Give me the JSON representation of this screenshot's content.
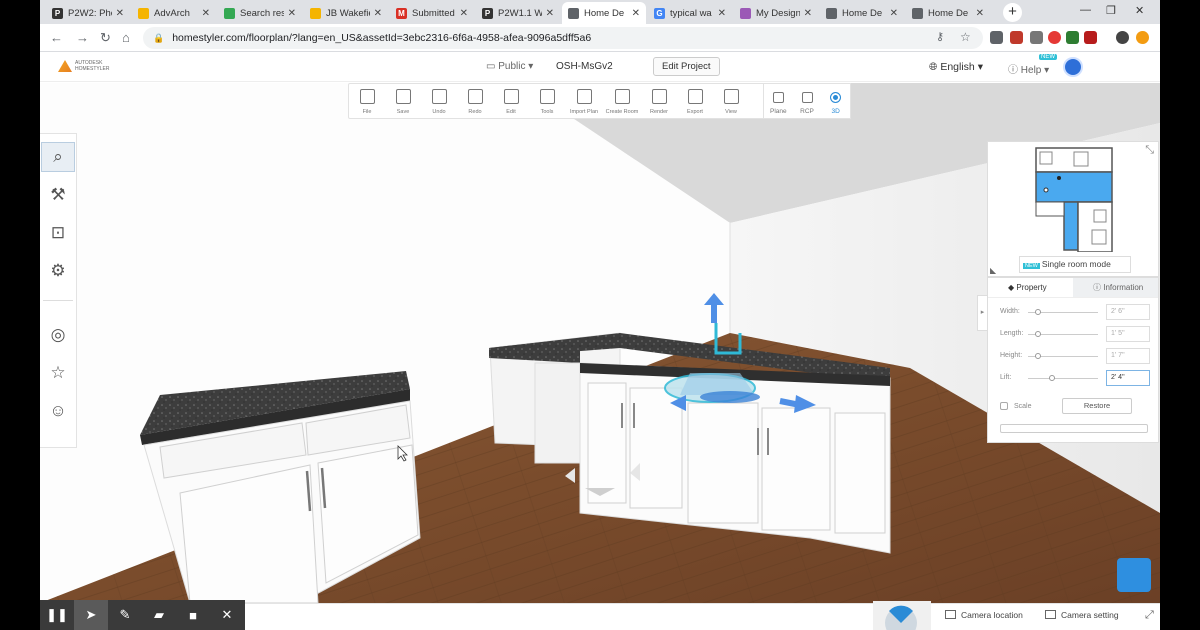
{
  "browser": {
    "tabs": [
      {
        "label": "P2W2: Pho",
        "fav": "#333",
        "letter": "P"
      },
      {
        "label": "AdvArch",
        "fav": "#f5b400",
        "letter": ""
      },
      {
        "label": "Search res",
        "fav": "#34a853",
        "letter": ""
      },
      {
        "label": "JB Wakefie",
        "fav": "#f5b400",
        "letter": ""
      },
      {
        "label": "Submitted",
        "fav": "#d93025",
        "letter": "M"
      },
      {
        "label": "P2W1.1 W",
        "fav": "#333",
        "letter": "P"
      },
      {
        "label": "Home De",
        "fav": "#5f6368",
        "letter": "",
        "active": true
      },
      {
        "label": "typical wa",
        "fav": "#4285f4",
        "letter": "G"
      },
      {
        "label": "My Design",
        "fav": "#9b59b6",
        "letter": ""
      },
      {
        "label": "Home De",
        "fav": "#5f6368",
        "letter": ""
      },
      {
        "label": "Home De",
        "fav": "#5f6368",
        "letter": ""
      }
    ],
    "new_tab": "+",
    "url": "homestyler.com/floorplan/?lang=en_US&assetId=3ebc2316-6f6a-4958-afea-9096a5dff5a6"
  },
  "header": {
    "logo_line1": "AUTODESK",
    "logo_line2": "HOMESTYLER",
    "visibility": "Public",
    "project_name": "OSH-MsGv2",
    "edit_project": "Edit Project",
    "language": "English",
    "help": "Help",
    "new_badge": "NEW"
  },
  "tools": [
    {
      "label": "File",
      "icon": "file-icon"
    },
    {
      "label": "Save",
      "icon": "save-icon"
    },
    {
      "label": "Undo",
      "icon": "undo-icon"
    },
    {
      "label": "Redo",
      "icon": "redo-icon"
    },
    {
      "label": "Edit",
      "icon": "edit-icon"
    },
    {
      "label": "Tools",
      "icon": "ruler-icon"
    },
    {
      "label": "Import Plan",
      "icon": "import-icon"
    },
    {
      "label": "Create Room",
      "icon": "create-room-icon"
    },
    {
      "label": "Render",
      "icon": "teapot-icon"
    },
    {
      "label": "Export",
      "icon": "export-icon"
    },
    {
      "label": "View",
      "icon": "eye-icon"
    }
  ],
  "views": [
    {
      "label": "Plane",
      "icon": "plane-icon"
    },
    {
      "label": "RCP",
      "icon": "rcp-icon"
    },
    {
      "label": "3D",
      "icon": "3d-icon",
      "active": true
    }
  ],
  "sidebar": {
    "items": [
      {
        "icon": "search-icon",
        "glyph": "⌕"
      },
      {
        "icon": "shovel-icon",
        "glyph": "⚒"
      },
      {
        "icon": "sofa-icon",
        "glyph": "⊡"
      },
      {
        "icon": "paint-roller-icon",
        "glyph": "⚙"
      },
      {
        "icon": "compass-icon",
        "glyph": "◎"
      },
      {
        "icon": "star-box-icon",
        "glyph": "☆"
      },
      {
        "icon": "user-circle-icon",
        "glyph": "☺"
      }
    ]
  },
  "minimap": {
    "single_room_badge": "NEW",
    "single_room_label": "Single room mode"
  },
  "property_panel": {
    "tab_property": "Property",
    "tab_information": "Information",
    "rows": [
      {
        "label": "Width:",
        "value": "2' 6\"",
        "level": 0.1
      },
      {
        "label": "Length:",
        "value": "1' 5\"",
        "level": 0.1
      },
      {
        "label": "Height:",
        "value": "1' 7\"",
        "level": 0.1
      },
      {
        "label": "Lift:",
        "value": "2' 4\"",
        "level": 0.3
      }
    ],
    "scale_label": "Scale",
    "restore": "Restore"
  },
  "recorder": {
    "buttons": [
      {
        "icon": "pause-icon",
        "glyph": "❚❚"
      },
      {
        "icon": "cursor-icon",
        "glyph": "➤"
      },
      {
        "icon": "pen-icon",
        "glyph": "✎"
      },
      {
        "icon": "highlighter-icon",
        "glyph": "▰"
      },
      {
        "icon": "camera-icon",
        "glyph": "■"
      },
      {
        "icon": "close-icon",
        "glyph": "✕"
      }
    ]
  },
  "bottom": {
    "camera_location": "Camera location",
    "camera_setting": "Camera setting"
  }
}
